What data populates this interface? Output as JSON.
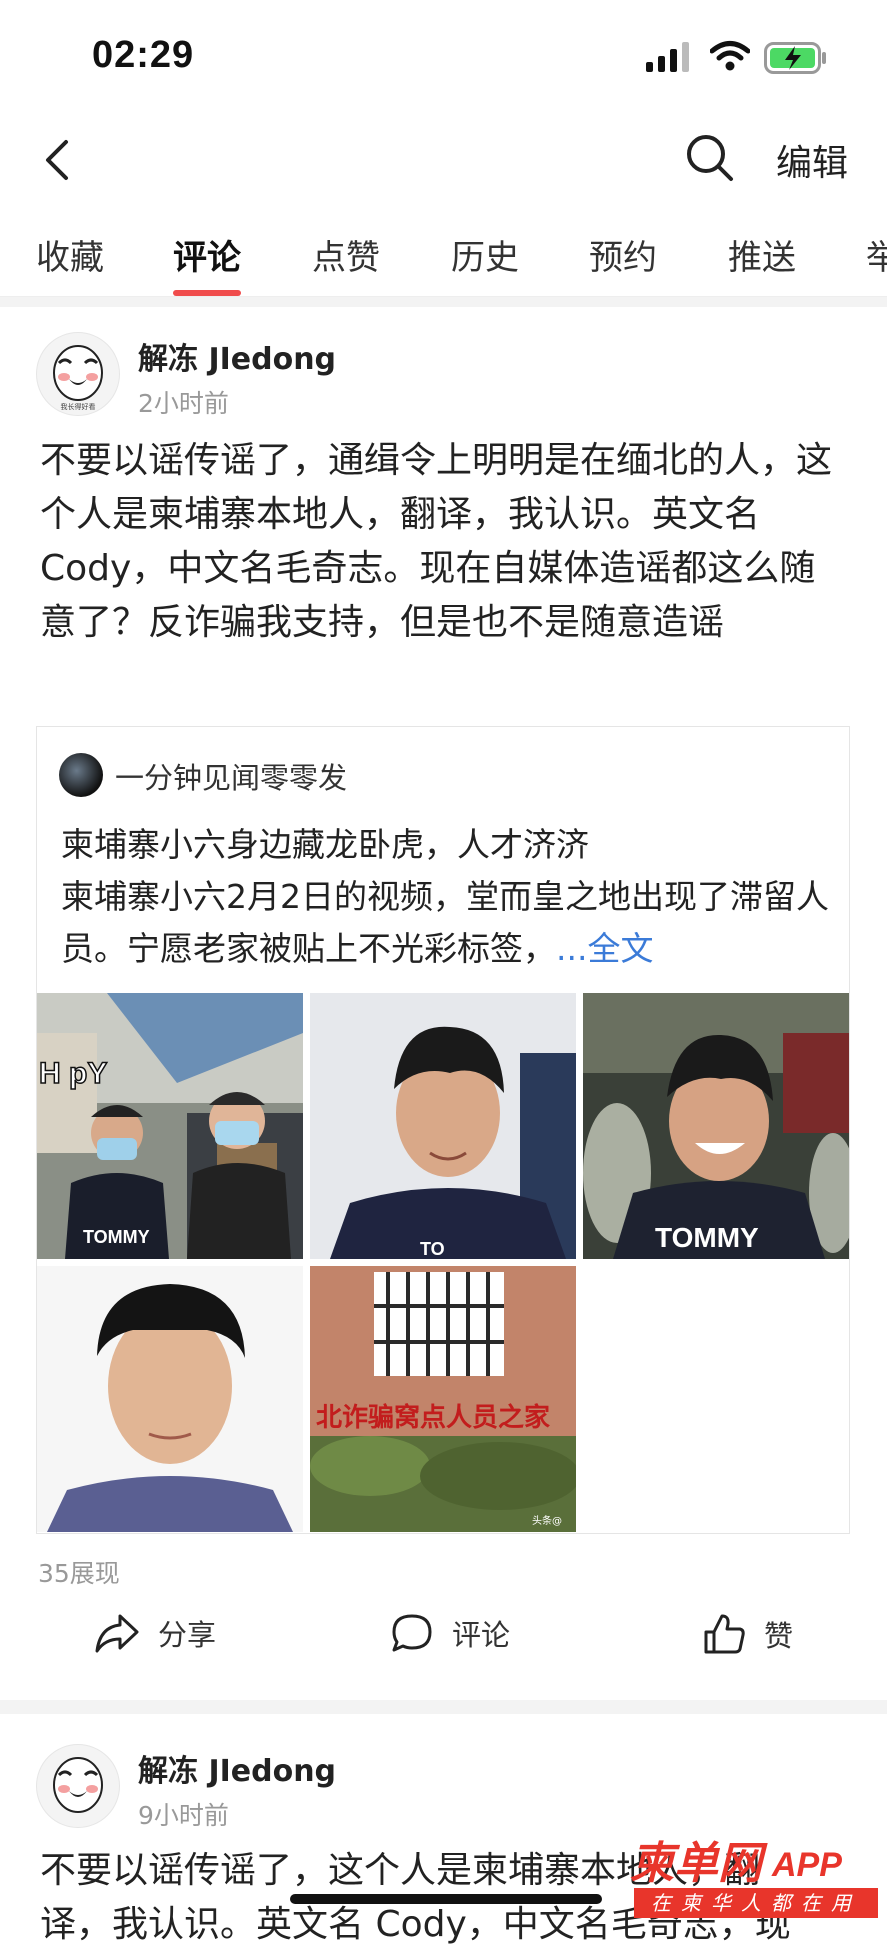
{
  "status": {
    "time": "02:29"
  },
  "nav": {
    "edit_label": "编辑"
  },
  "tabs": [
    "收藏",
    "评论",
    "点赞",
    "历史",
    "预约",
    "推送",
    "举"
  ],
  "active_tab": "评论",
  "posts": [
    {
      "author": "解冻 JIedong",
      "time": "2小时前",
      "avatar_caption": "我长得好看",
      "text": "不要以谣传谣了，通缉令上明明是在缅北的人，这个人是柬埔寨本地人，翻译，我认识。英文名 Cody，中文名毛奇志。现在自媒体造谣都这么随意了？反诈骗我支持，但是也不是随意造谣",
      "quote": {
        "source": "一分钟见闻零零发",
        "line1": "柬埔寨小六身边藏龙卧虎，人才济济",
        "line2": "柬埔寨小六2月2日的视频，堂而皇之地出现了滞留人员。宁愿老家被贴上不光彩标签，",
        "more": "...全文",
        "images": [
          {
            "overlay_text": "H   pY",
            "shirt_text": "TOMMY"
          },
          {
            "shirt_text": "TO"
          },
          {
            "shirt_text": "TOMMY"
          },
          {},
          {
            "wall_text": "北诈骗窝点人员之家",
            "corner_text": "头条@"
          }
        ]
      },
      "views": "35展现",
      "actions": {
        "share": "分享",
        "comment": "评论",
        "like": "赞"
      }
    },
    {
      "author": "解冻 JIedong",
      "time": "9小时前",
      "text_line1": "不要以谣传谣了，这个人是柬埔寨本地人，翻",
      "text_line2": "译，我认识。英文名 Cody，中文名毛奇志，现"
    }
  ],
  "watermark": {
    "brand": "柬单网",
    "suffix": "APP",
    "slogan": "在柬华人都在用"
  },
  "colors": {
    "accent": "#f04c4c",
    "link": "#3b7bd8",
    "muted": "#999999",
    "watermark": "#e8352b"
  }
}
